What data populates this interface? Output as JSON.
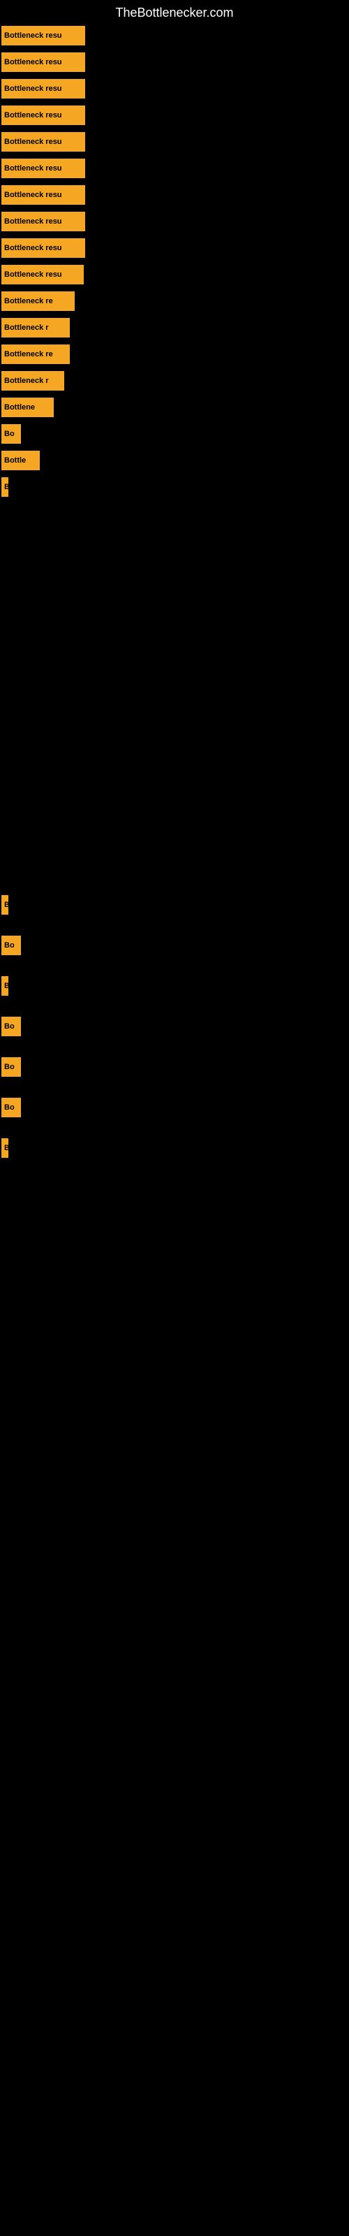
{
  "site": {
    "title": "TheBottlenecker.com"
  },
  "rows": [
    {
      "id": 1,
      "label": "Bottleneck resu",
      "class": "row-1"
    },
    {
      "id": 2,
      "label": "Bottleneck resu",
      "class": "row-2"
    },
    {
      "id": 3,
      "label": "Bottleneck resu",
      "class": "row-3"
    },
    {
      "id": 4,
      "label": "Bottleneck resu",
      "class": "row-4"
    },
    {
      "id": 5,
      "label": "Bottleneck resu",
      "class": "row-5"
    },
    {
      "id": 6,
      "label": "Bottleneck resu",
      "class": "row-6"
    },
    {
      "id": 7,
      "label": "Bottleneck resu",
      "class": "row-7"
    },
    {
      "id": 8,
      "label": "Bottleneck resu",
      "class": "row-8"
    },
    {
      "id": 9,
      "label": "Bottleneck resu",
      "class": "row-9"
    },
    {
      "id": 10,
      "label": "Bottleneck resu",
      "class": "row-10"
    },
    {
      "id": 11,
      "label": "Bottleneck re",
      "class": "row-11"
    },
    {
      "id": 12,
      "label": "Bottleneck r",
      "class": "row-12"
    },
    {
      "id": 13,
      "label": "Bottleneck re",
      "class": "row-13"
    },
    {
      "id": 14,
      "label": "Bottleneck r",
      "class": "row-14"
    },
    {
      "id": 15,
      "label": "Bottlene",
      "class": "row-15"
    },
    {
      "id": 16,
      "label": "Bo",
      "class": "row-16"
    },
    {
      "id": 17,
      "label": "Bottle",
      "class": "row-17"
    },
    {
      "id": 18,
      "label": "B",
      "class": "row-18"
    },
    {
      "id": 19,
      "label": "B",
      "class": "row-19"
    },
    {
      "id": 20,
      "label": "Bo",
      "class": "row-20"
    },
    {
      "id": 21,
      "label": "B",
      "class": "row-21"
    },
    {
      "id": 22,
      "label": "Bo",
      "class": "row-22"
    },
    {
      "id": 23,
      "label": "Bo",
      "class": "row-23"
    },
    {
      "id": 24,
      "label": "Bo",
      "class": "row-24"
    },
    {
      "id": 25,
      "label": "B",
      "class": "row-25"
    }
  ]
}
